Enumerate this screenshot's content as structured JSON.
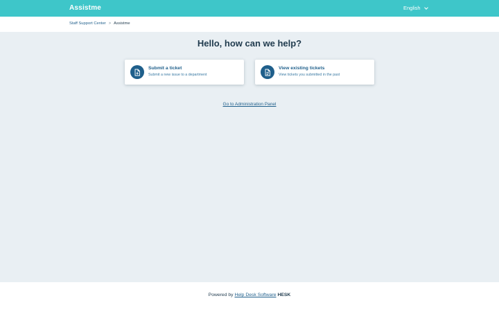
{
  "header": {
    "brand": "Assistme",
    "language": "English"
  },
  "breadcrumb": {
    "items": [
      "Staff Support Center",
      "Assistme"
    ],
    "separator": ">"
  },
  "main": {
    "heading": "Hello, how can we help?",
    "cards": [
      {
        "title": "Submit a ticket",
        "description": "Submit a new issue to a department",
        "icon": "document-add-icon"
      },
      {
        "title": "View existing tickets",
        "description": "View tickets you submitted in the past",
        "icon": "document-view-icon"
      }
    ],
    "admin_link": "Go to Administration Panel"
  },
  "footer": {
    "powered_by": "Powered by",
    "link_text": "Help Desk Software",
    "product": "HESK"
  },
  "colors": {
    "topbar": "#3ec6c9",
    "accent": "#1f5f8b",
    "background": "#e9eff3"
  }
}
